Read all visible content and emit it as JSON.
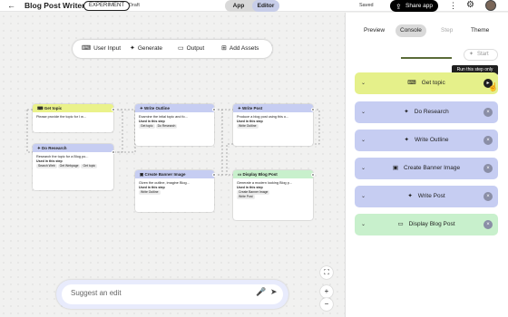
{
  "header": {
    "back_icon": "arrow-left-icon",
    "title": "Blog Post Writer",
    "badge": "EXPERIMENT",
    "status": "Draft",
    "mode_app": "App",
    "mode_editor": "Editor",
    "saved": "Saved",
    "share": "Share app"
  },
  "toolbar": {
    "user_input": "User Input",
    "generate": "Generate",
    "output": "Output",
    "add_assets": "Add Assets"
  },
  "nodes": {
    "get_topic": {
      "title": "Get topic",
      "body": "Please provide the topic for I w..."
    },
    "do_research": {
      "title": "Do Research",
      "body": "Research the topic for a Blog po...",
      "used": "Used in this step",
      "chips": [
        "Search Web",
        "Get Webpage",
        "Get topic"
      ]
    },
    "write_outline": {
      "title": "Write Outline",
      "body": "Examine the intial topic and fo...",
      "used": "Used in this step",
      "chips": [
        "Get topic",
        "Do Research"
      ]
    },
    "write_post": {
      "title": "Write Post",
      "body": "Produce a blog post using this o...",
      "used": "Used in this step",
      "chips": [
        "Write Outline"
      ]
    },
    "create_banner": {
      "title": "Create Banner Image",
      "body": "Given the outline, imagine Blog...",
      "used": "Used in this step",
      "chips": [
        "Write Outline"
      ]
    },
    "display_post": {
      "title": "Display Blog Post",
      "body": "Generate a modern looking Blog p...",
      "used": "Used in this step",
      "chips": [
        "Create Banner Image",
        "Write Post"
      ]
    }
  },
  "edit": {
    "placeholder": "Suggest an edit"
  },
  "panel": {
    "tabs": [
      "Preview",
      "Console",
      "Step",
      "Theme"
    ],
    "start": "Start",
    "tooltip": "Run this step only",
    "steps": [
      {
        "label": "Get topic",
        "icon": "keyboard-icon",
        "color": "#e5f08a"
      },
      {
        "label": "Do Research",
        "icon": "sparkle-icon",
        "color": "#c6cdf2"
      },
      {
        "label": "Write Outline",
        "icon": "sparkle-icon",
        "color": "#c6cdf2"
      },
      {
        "label": "Create Banner Image",
        "icon": "image-icon",
        "color": "#c6cdf2"
      },
      {
        "label": "Write Post",
        "icon": "sparkle-icon",
        "color": "#c6cdf2"
      },
      {
        "label": "Display Blog Post",
        "icon": "display-icon",
        "color": "#c8f0cc"
      }
    ]
  }
}
